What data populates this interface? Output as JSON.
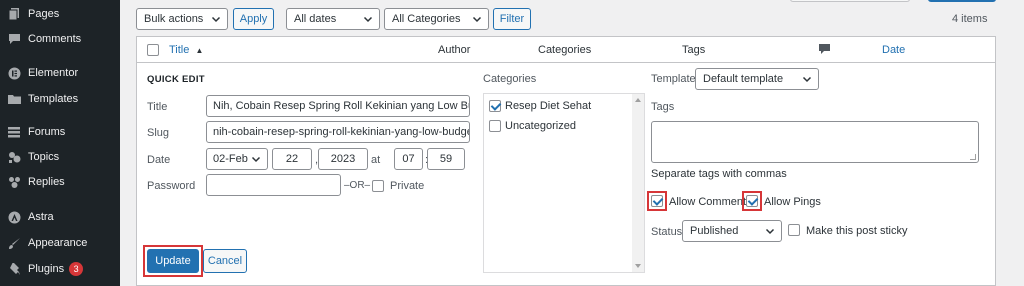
{
  "sidebar": {
    "items": [
      {
        "label": "Pages",
        "icon": "pages-icon"
      },
      {
        "label": "Comments",
        "icon": "comments-icon"
      },
      {
        "label": "Elementor",
        "icon": "elementor-icon"
      },
      {
        "label": "Templates",
        "icon": "folder-icon"
      },
      {
        "label": "Forums",
        "icon": "forums-icon"
      },
      {
        "label": "Topics",
        "icon": "topics-icon"
      },
      {
        "label": "Replies",
        "icon": "replies-icon"
      },
      {
        "label": "Astra",
        "icon": "astra-icon"
      },
      {
        "label": "Appearance",
        "icon": "brush-icon"
      },
      {
        "label": "Plugins",
        "icon": "plugin-icon",
        "badge": "3"
      }
    ]
  },
  "toolbar": {
    "bulk_actions": "Bulk actions",
    "apply": "Apply",
    "dates": "All dates",
    "categories": "All Categories",
    "filter": "Filter",
    "item_count": "4 items"
  },
  "table": {
    "headers": {
      "title": "Title",
      "sort_indicator": "▲",
      "author": "Author",
      "categories": "Categories",
      "tags": "Tags",
      "comments_icon": "comment-bubble-icon",
      "date": "Date"
    }
  },
  "quick_edit": {
    "heading": "QUICK EDIT",
    "title_label": "Title",
    "title_value": "Nih, Cobain Resep Spring Roll Kekinian yang Low Budget",
    "slug_label": "Slug",
    "slug_value": "nih-cobain-resep-spring-roll-kekinian-yang-low-budget",
    "date_label": "Date",
    "month": "02-Feb",
    "day": "22",
    "comma": ",",
    "year": "2023",
    "at": "at",
    "hour": "07",
    "colon": ":",
    "minute": "59",
    "password_label": "Password",
    "password_value": "",
    "or_label": "–OR–",
    "private_label": "Private",
    "categories_label": "Categories",
    "categories": [
      {
        "label": "Resep Diet Sehat",
        "checked": true
      },
      {
        "label": "Uncategorized",
        "checked": false
      }
    ],
    "template_label": "Template",
    "template_value": "Default template",
    "tags_label": "Tags",
    "tags_hint": "Separate tags with commas",
    "allow_comments_label": "Allow Comments",
    "allow_comments": true,
    "allow_pings_label": "Allow Pings",
    "allow_pings": true,
    "status_label": "Status",
    "status_value": "Published",
    "sticky_label": "Make this post sticky",
    "update": "Update",
    "cancel": "Cancel"
  },
  "colors": {
    "sidebar_bg": "#1d2327",
    "accent": "#2271b1",
    "highlight_box": "#d63638",
    "badge": "#d63638"
  }
}
